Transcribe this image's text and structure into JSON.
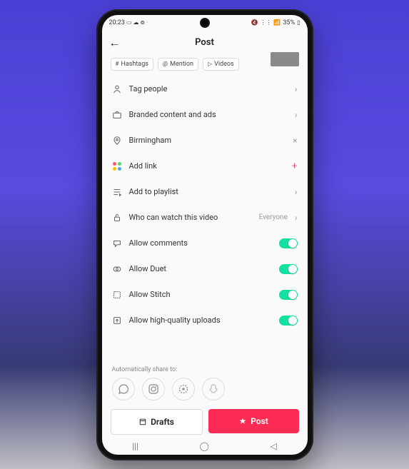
{
  "status": {
    "time": "20:23",
    "battery": "35%"
  },
  "header": {
    "title": "Post"
  },
  "chips": {
    "hashtags": "Hashtags",
    "mention": "Mention",
    "videos": "Videos"
  },
  "rows": {
    "tag_people": "Tag people",
    "branded": "Branded content and ads",
    "location": "Birmingham",
    "add_link": "Add link",
    "add_playlist": "Add to playlist",
    "who_watch": "Who can watch this video",
    "who_watch_value": "Everyone",
    "allow_comments": "Allow comments",
    "allow_duet": "Allow Duet",
    "allow_stitch": "Allow Stitch",
    "allow_hq": "Allow high-quality uploads"
  },
  "share_label": "Automatically share to:",
  "buttons": {
    "drafts": "Drafts",
    "post": "Post"
  }
}
